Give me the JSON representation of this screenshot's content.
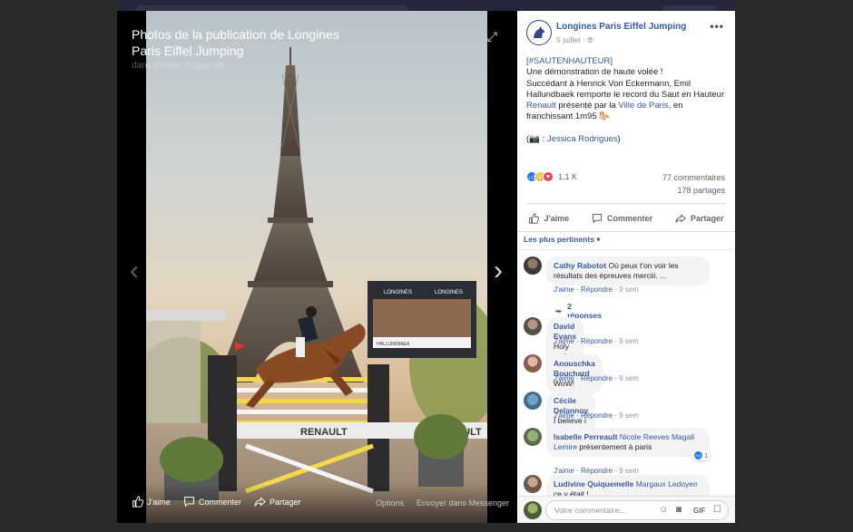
{
  "viewer": {
    "title": "Photos de la publication de Longines Paris Eiffel Jumping",
    "subtitle": "dans Vidéos du journal",
    "actions": {
      "like": "J'aime",
      "comment": "Commenter",
      "share": "Partager",
      "options": "Options",
      "send": "Envoyer dans Messenger"
    },
    "board": {
      "brand": "LONGINES",
      "rider": "HALLUNDBAEK"
    },
    "fence": {
      "brand": "RENAULT"
    }
  },
  "post": {
    "page_name": "Longines Paris Eiffel Jumping",
    "date": "5 juillet",
    "hashtag": "[#SAUTENHAUTEUR]",
    "line1": "Une démonstration de haute volée !",
    "line2a": "Succédant à Henrick Von Eckermann, Emil Hallundbaek remporte le record du Saut en Hauteur ",
    "link_renault": "Renault",
    "line2b": " présenté par la ",
    "link_ville": "Ville de Paris",
    "line2c": ", en franchissant 1m95 🐎",
    "credit_prefix": "(📷 : ",
    "credit_name": "Jessica Rodrigues",
    "credit_suffix": ")",
    "reactions_count": "1,1 K",
    "comments_count": "77 commentaires",
    "shares_count": "178 partages",
    "actions": {
      "like": "J'aime",
      "comment": "Commenter",
      "share": "Partager"
    },
    "sort_label": "Les plus pertinents ▾"
  },
  "comments": [
    {
      "name": "Cathy Rabotot",
      "text": "Où peux t'on voir les résultats des épreuves merciii. ...",
      "like": "J'aime",
      "reply": "Répondre",
      "time": "9 sem",
      "replies": "2 réponses"
    },
    {
      "name": "David Evans",
      "text": "Holy moly terrific",
      "like": "J'aime",
      "reply": "Répondre",
      "time": "9 sem"
    },
    {
      "name": "Anouschka Bouchard",
      "text": "WoW!",
      "like": "J'aime",
      "reply": "Répondre",
      "time": "9 sem"
    },
    {
      "name": "Cécile Delannoy",
      "text": "I believe i can fly",
      "like": "J'aime",
      "reply": "Répondre",
      "time": "9 sem"
    },
    {
      "name": "Isabelle Perreault",
      "mention": "Nicole Reeves Magali Lemire",
      "text": "présentement à paris",
      "like": "J'aime",
      "reply": "Répondre",
      "time": "9 sem",
      "likes": "1"
    },
    {
      "name": "Ludivine Quiquemelle",
      "mention": "Margaux Ledoyen",
      "text": "ce y était !"
    }
  ],
  "composer": {
    "placeholder": "Votre commentaire..."
  },
  "colors": {
    "link": "#385898",
    "background": "#2a2a2a",
    "panel": "#ffffff"
  }
}
